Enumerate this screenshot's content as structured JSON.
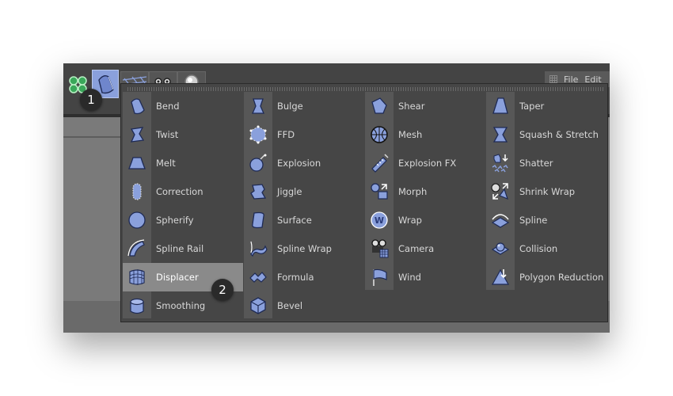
{
  "colors": {
    "accent_icon": "#8aa0dc",
    "popup_bg": "#464646",
    "selected_bg": "#8a8a8a"
  },
  "menubar": {
    "file_label": "File",
    "edit_label": "Edit"
  },
  "badges": {
    "one": "1",
    "two": "2"
  },
  "deformers": {
    "columns": [
      {
        "items": [
          {
            "label": "Bend",
            "icon": "bend-icon"
          },
          {
            "label": "Twist",
            "icon": "twist-icon"
          },
          {
            "label": "Melt",
            "icon": "melt-icon"
          },
          {
            "label": "Correction",
            "icon": "correction-icon"
          },
          {
            "label": "Spherify",
            "icon": "spherify-icon"
          },
          {
            "label": "Spline Rail",
            "icon": "spline-rail-icon"
          },
          {
            "label": "Displacer",
            "icon": "displacer-icon",
            "selected": true
          },
          {
            "label": "Smoothing",
            "icon": "smoothing-icon"
          }
        ]
      },
      {
        "items": [
          {
            "label": "Bulge",
            "icon": "bulge-icon"
          },
          {
            "label": "FFD",
            "icon": "ffd-icon"
          },
          {
            "label": "Explosion",
            "icon": "explosion-icon"
          },
          {
            "label": "Jiggle",
            "icon": "jiggle-icon"
          },
          {
            "label": "Surface",
            "icon": "surface-icon"
          },
          {
            "label": "Spline Wrap",
            "icon": "spline-wrap-icon"
          },
          {
            "label": "Formula",
            "icon": "formula-icon"
          },
          {
            "label": "Bevel",
            "icon": "bevel-icon"
          }
        ]
      },
      {
        "items": [
          {
            "label": "Shear",
            "icon": "shear-icon"
          },
          {
            "label": "Mesh",
            "icon": "mesh-icon"
          },
          {
            "label": "Explosion FX",
            "icon": "explosion-fx-icon"
          },
          {
            "label": "Morph",
            "icon": "morph-icon"
          },
          {
            "label": "Wrap",
            "icon": "wrap-icon"
          },
          {
            "label": "Camera",
            "icon": "camera-icon"
          },
          {
            "label": "Wind",
            "icon": "wind-icon"
          }
        ]
      },
      {
        "items": [
          {
            "label": "Taper",
            "icon": "taper-icon"
          },
          {
            "label": "Squash & Stretch",
            "icon": "squash-stretch-icon"
          },
          {
            "label": "Shatter",
            "icon": "shatter-icon"
          },
          {
            "label": "Shrink Wrap",
            "icon": "shrink-wrap-icon"
          },
          {
            "label": "Spline",
            "icon": "spline-icon"
          },
          {
            "label": "Collision",
            "icon": "collision-icon"
          },
          {
            "label": "Polygon Reduction",
            "icon": "polygon-reduction-icon"
          }
        ]
      }
    ]
  }
}
